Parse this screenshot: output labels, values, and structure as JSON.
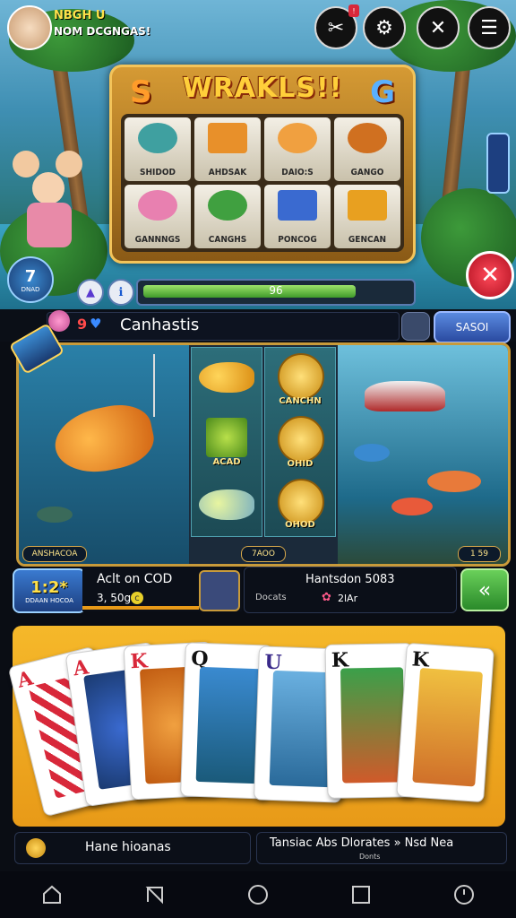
{
  "profile": {
    "line1": "NBGH U",
    "line2": "NOM DCGNGAS!"
  },
  "top_icons": [
    "tools-icon",
    "gear-icon",
    "close-tools-icon",
    "menu-icon"
  ],
  "slot": {
    "title": "WRAKLS!!",
    "left_letter": "S",
    "right_letter": "G",
    "symbols": [
      {
        "label": "SHIDOD",
        "color": "#3fa0a0"
      },
      {
        "label": "AHDSAK",
        "color": "#e8902a"
      },
      {
        "label": "DAIO:S",
        "color": "#f0a040"
      },
      {
        "label": "GANGO",
        "color": "#d07020"
      },
      {
        "label": "GANNNGS",
        "color": "#e880b0"
      },
      {
        "label": "CANGHS",
        "color": "#40a040"
      },
      {
        "label": "PONCOG",
        "color": "#3a6ad0"
      },
      {
        "label": "GENCAN",
        "color": "#e8a020"
      }
    ]
  },
  "side_badge": "7",
  "side_badge_caption": "DNAD",
  "progress": {
    "value": 0.8,
    "label": "96"
  },
  "mid": {
    "gem_label": "9",
    "title": "Canhastis",
    "button": "SASOI"
  },
  "reels": {
    "col1": [
      "",
      "ACAD",
      ""
    ],
    "col2": [
      "CANCHN",
      "OHID",
      "OHOD"
    ]
  },
  "panel_badges": {
    "left": "ANSHACOA",
    "center": "7AOO",
    "right": "1 59"
  },
  "multiplier": {
    "value": "1:2*",
    "caption": "DDAAN HOCOA"
  },
  "info1": {
    "title": "Aclt on COD",
    "value": "3, 50g"
  },
  "info2": {
    "title": "Hantsdon 5083",
    "sub1": "Docats",
    "sub2": "2lAr"
  },
  "cards": [
    "A",
    "A",
    "K",
    "Q",
    "U",
    "K",
    "K"
  ],
  "bottom": {
    "left_text": "Hane hioanas",
    "right_text": "Tansiac Abs Dlorates » Nsd Nea",
    "right_sub": "Donts"
  },
  "nav": [
    "home-icon",
    "back-icon",
    "circle-home-icon",
    "recents-icon",
    "clock-icon"
  ],
  "colors": {
    "accent_gold": "#f3c45a",
    "panel_orange": "#f5b82a",
    "close_red": "#d8283a",
    "progress_green": "#6ac040"
  }
}
